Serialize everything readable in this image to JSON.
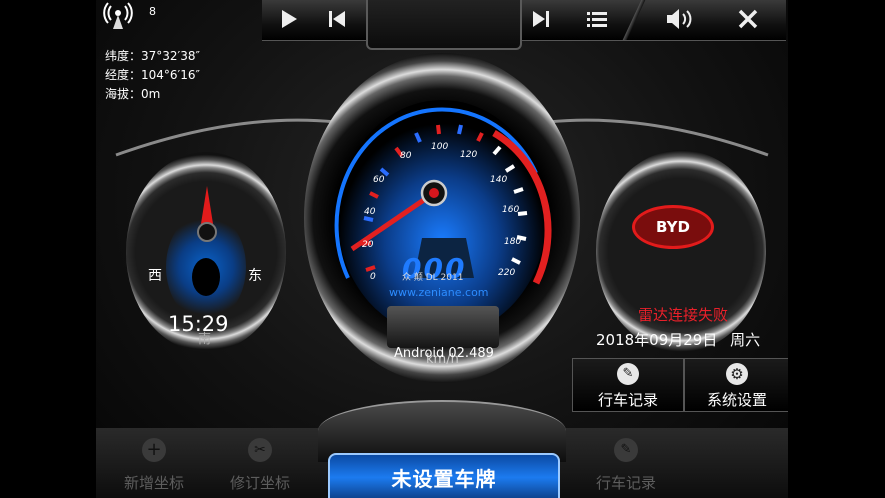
{
  "status": {
    "signal_count": "8"
  },
  "gps": {
    "latitude": "纬度：37°32′38″",
    "longitude": "经度：104°6′16″",
    "altitude": "海拔：0m"
  },
  "compass": {
    "west": "西",
    "east": "东",
    "time": "15:29",
    "south": "南"
  },
  "speedometer": {
    "ticks": [
      "0",
      "20",
      "40",
      "60",
      "80",
      "100",
      "120",
      "140",
      "160",
      "180",
      "220"
    ],
    "speed": "000",
    "unit": "km/h",
    "watermark_name": "众 颠 DL 2011",
    "watermark_url": "www.zeniane.com",
    "version": "Android 02.489"
  },
  "right_panel": {
    "brand": "BYD",
    "radar_status": "雷达连接失败",
    "date": "2018年09月29日",
    "weekday": "周六"
  },
  "right_buttons": {
    "trip_log": "行车记录",
    "settings": "系统设置"
  },
  "bottom": {
    "add_coord": "新增坐标",
    "edit_coord": "修订坐标",
    "plate": "未设置车牌",
    "trip_log": "行车记录"
  },
  "colors": {
    "accent_blue": "#1c7bf0",
    "alert_red": "#e8202a",
    "needle_red": "#d6161d"
  }
}
